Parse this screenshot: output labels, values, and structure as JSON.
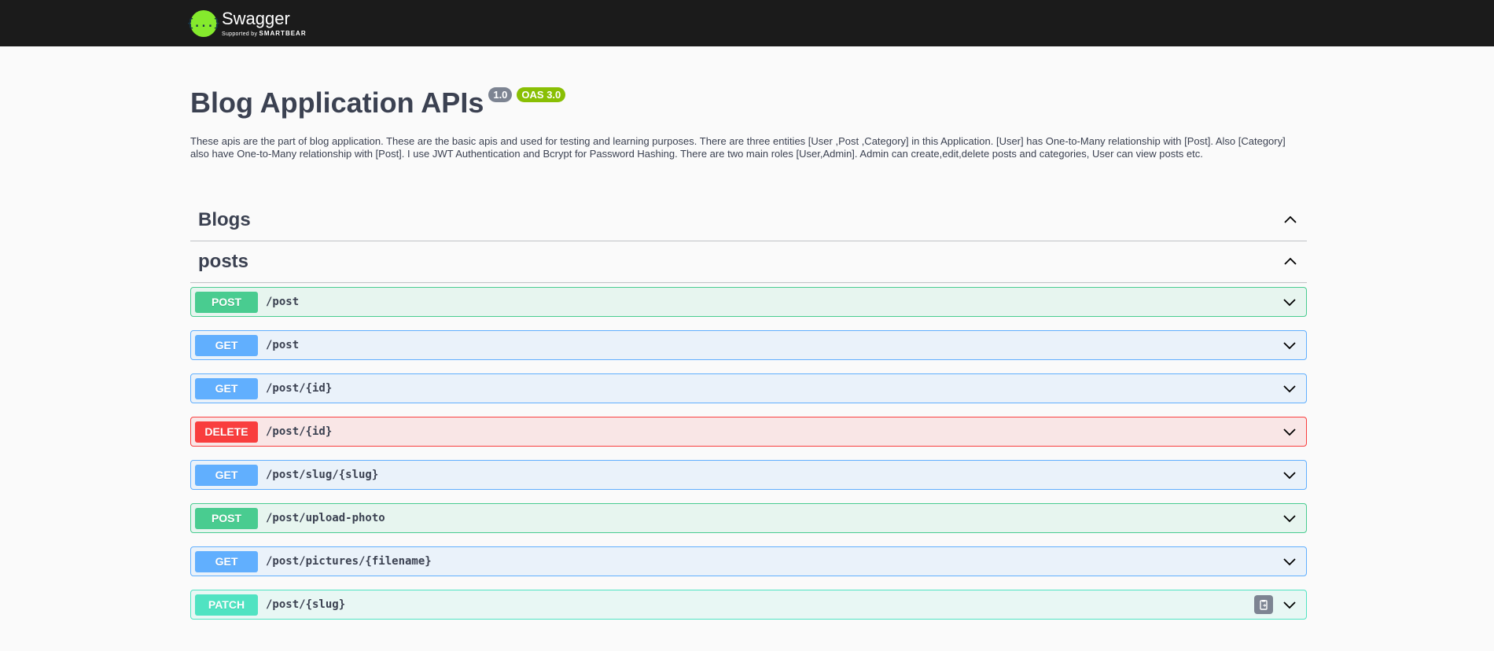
{
  "topbar": {
    "logo_symbol": "{...}",
    "logo_name": "Swagger",
    "logo_sub_prefix": "Supported by",
    "logo_sub_brand": "SMARTBEAR"
  },
  "info": {
    "title": "Blog Application APIs",
    "version": "1.0",
    "oas": "OAS 3.0",
    "description": "These apis are the part of blog application. These are the basic apis and used for testing and learning purposes. There are three entities [User ,Post ,Category] in this Application. [User] has One-to-Many relationship with [Post]. Also [Category] also have One-to-Many relationship with [Post]. I use JWT Authentication and Bcrypt for Password Hashing. There are two main roles [User,Admin]. Admin can create,edit,delete posts and categories, User can view posts etc."
  },
  "sections": {
    "blogs": {
      "title": "Blogs"
    },
    "posts": {
      "title": "posts"
    }
  },
  "operations": [
    {
      "method": "POST",
      "path": "/post"
    },
    {
      "method": "GET",
      "path": "/post"
    },
    {
      "method": "GET",
      "path": "/post/{id}"
    },
    {
      "method": "DELETE",
      "path": "/post/{id}"
    },
    {
      "method": "GET",
      "path": "/post/slug/{slug}"
    },
    {
      "method": "POST",
      "path": "/post/upload-photo"
    },
    {
      "method": "GET",
      "path": "/post/pictures/{filename}"
    },
    {
      "method": "PATCH",
      "path": "/post/{slug}"
    }
  ],
  "colors": {
    "post": "#49cc90",
    "get": "#61affe",
    "delete": "#f93e3e",
    "patch": "#50e3c2",
    "topbar": "#1b1b1b",
    "logo": "#85ea2d"
  },
  "icons": {
    "logo": "swagger-logo-icon",
    "collapse": "chevron-up-icon",
    "expand": "chevron-down-icon",
    "copy": "copy-to-clipboard-icon"
  }
}
